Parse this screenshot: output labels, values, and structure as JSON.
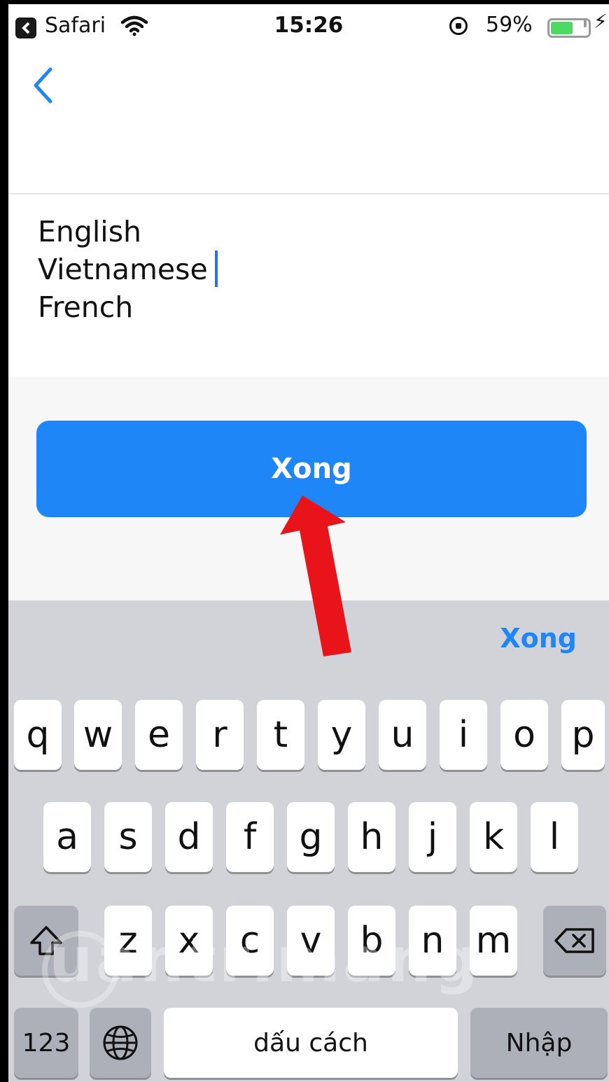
{
  "status_bar": {
    "app_name": "Safari",
    "time": "15:26",
    "battery_percent": "59%",
    "battery_level": 0.59
  },
  "text_area": {
    "lines": [
      "English",
      "Vietnamese",
      "French"
    ]
  },
  "done_button": {
    "label": "Xong"
  },
  "keyboard": {
    "done_label": "Xong",
    "row1": [
      "q",
      "w",
      "e",
      "r",
      "t",
      "y",
      "u",
      "i",
      "o",
      "p"
    ],
    "row2": [
      "a",
      "s",
      "d",
      "f",
      "g",
      "h",
      "j",
      "k",
      "l"
    ],
    "row3": [
      "z",
      "x",
      "c",
      "v",
      "b",
      "n",
      "m"
    ],
    "numbers_label": "123",
    "space_label": "dấu cách",
    "return_label": "Nhập",
    "icons": {
      "shift": "shift-icon",
      "delete": "backspace-icon",
      "globe": "globe-icon"
    }
  },
  "watermark": "uantrimang",
  "colors": {
    "accent": "#1e86f7",
    "arrow": "#e8141a",
    "keyboard_bg": "#d1d3d9"
  }
}
